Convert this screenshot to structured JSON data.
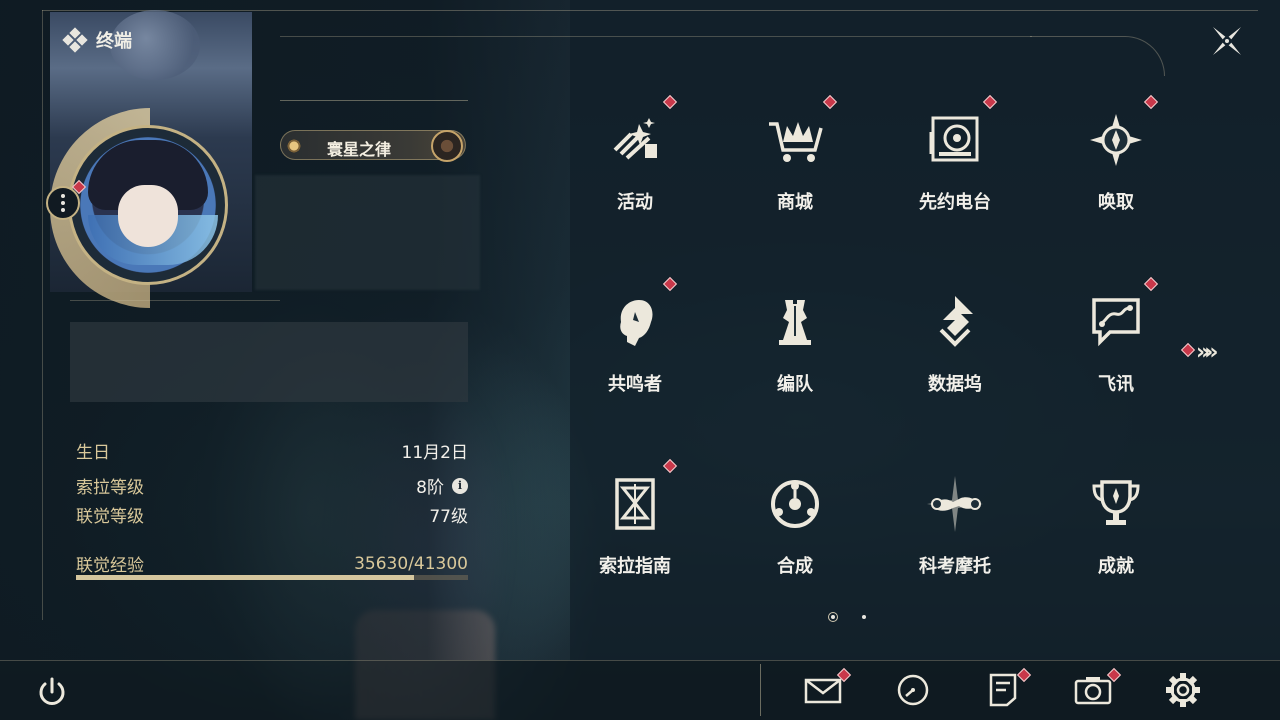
{
  "header": {
    "title": "终端"
  },
  "profile": {
    "title_badge": "寰星之律"
  },
  "stats": [
    {
      "label": "生日",
      "value": "11月2日"
    },
    {
      "label": "索拉等级",
      "value": "8阶"
    },
    {
      "label": "联觉等级",
      "value": "77级"
    },
    {
      "label": "联觉经验",
      "value": "35630/41300"
    }
  ],
  "experience": {
    "current": 35630,
    "max": 41300,
    "fraction": 0.8627
  },
  "menu": [
    {
      "label": "活动",
      "icon": "activity-icon",
      "badge": true
    },
    {
      "label": "商城",
      "icon": "shop-cart-icon",
      "badge": true
    },
    {
      "label": "先约电台",
      "icon": "radio-icon",
      "badge": true
    },
    {
      "label": "唤取",
      "icon": "convene-compass-icon",
      "badge": true
    },
    {
      "label": "共鸣者",
      "icon": "resonator-head-icon",
      "badge": true
    },
    {
      "label": "编队",
      "icon": "chess-team-icon",
      "badge": false
    },
    {
      "label": "数据坞",
      "icon": "data-bank-icon",
      "badge": false
    },
    {
      "label": "飞讯",
      "icon": "message-chat-icon",
      "badge": true
    },
    {
      "label": "索拉指南",
      "icon": "guide-book-icon",
      "badge": true
    },
    {
      "label": "合成",
      "icon": "synthesis-orb-icon",
      "badge": false
    },
    {
      "label": "科考摩托",
      "icon": "motorbike-icon",
      "badge": false
    },
    {
      "label": "成就",
      "icon": "trophy-icon",
      "badge": false
    }
  ],
  "pagination": {
    "current": 1,
    "total": 2
  },
  "bottom_icons": [
    "mail-icon",
    "clock-icon",
    "notes-icon",
    "camera-icon",
    "settings-gear-icon"
  ],
  "colors": {
    "accent_gold": "#d5c69e",
    "badge_red": "#c9384a",
    "text": "#f2f0ea",
    "panel": "#14232e"
  }
}
